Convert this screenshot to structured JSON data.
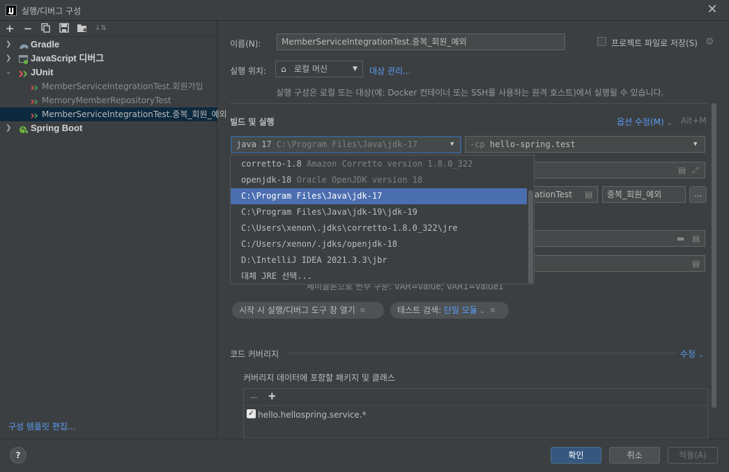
{
  "window": {
    "title": "실행/디버그 구성"
  },
  "left": {
    "toolbar": [
      "add",
      "remove",
      "copy",
      "save",
      "new-folder",
      "sort"
    ],
    "tree": [
      {
        "label": "Gradle",
        "kind": "group",
        "expanded": false
      },
      {
        "label": "JavaScript 디버그",
        "kind": "group",
        "expanded": false
      },
      {
        "label": "JUnit",
        "kind": "group",
        "expanded": true
      },
      {
        "label": "MemberServiceIntegrationTest.회원가입",
        "kind": "test"
      },
      {
        "label": "MemoryMemberRepositoryTest",
        "kind": "test"
      },
      {
        "label": "MemberServiceIntegrationTest.중복_회원_예외",
        "kind": "test",
        "selected": true
      },
      {
        "label": "Spring Boot",
        "kind": "group",
        "expanded": false
      }
    ],
    "template_link": "구성 템플릿 편집..."
  },
  "form": {
    "name_label": "이름(N):",
    "name_value": "MemberServiceIntegrationTest.중복_회원_예외",
    "save_to_project": "프로젝트 파일로 저장(S)",
    "run_on_label": "실행 위치:",
    "run_on_value": "로컬 머신",
    "manage_targets": "대상 관리...",
    "run_on_hint": "실행 구성은 로컬 또는 대상(예: Docker 컨테이너 또는 SSH를 사용하는 원격 호스트)에서 실행될 수 있습니다.",
    "build_run_header": "빌드 및 실행",
    "modify_options": "옵션 수정(M)",
    "modify_shortcut": "Alt+M",
    "jre_name": "java 17",
    "jre_path": "C:\\Program Files\\Java\\jdk-17",
    "cp_flag": "-cp",
    "cp_value": "hello-spring.test",
    "class_value_tail": "ationTest",
    "method_value": "중복_회원_예외",
    "browse_button": "...",
    "env_hint": "세미콜론으로 변수 구분: VAR=value; VAR1=value1",
    "chip_open_tool": "시작 시 실행/디버그 도구 창 열기",
    "chip_search_label": "테스트 검색:",
    "chip_search_value": "단일 모듈",
    "coverage_header": "코드 커버리지",
    "coverage_edit": "수정",
    "coverage_sub": "커버리지 데이터에 포함할 패키지 및 클래스",
    "coverage_item": "hello.hellospring.service.*"
  },
  "jre_dropdown": [
    {
      "main": "corretto-1.8",
      "sub": "Amazon Corretto version 1.8.0_322"
    },
    {
      "main": "openjdk-18",
      "sub": "Oracle OpenJDK version 18"
    },
    {
      "main": "C:\\Program Files\\Java\\jdk-17",
      "sub": "",
      "selected": true
    },
    {
      "main": "C:\\Program Files\\Java\\jdk-19\\jdk-19",
      "sub": ""
    },
    {
      "main": "C:\\Users\\xenon\\.jdks\\corretto-1.8.0_322\\jre",
      "sub": ""
    },
    {
      "main": "C:/Users/xenon/.jdks/openjdk-18",
      "sub": ""
    },
    {
      "main": "D:\\IntelliJ IDEA 2021.3.3\\jbr",
      "sub": ""
    },
    {
      "main": "대체 JRE 선택...",
      "sub": ""
    }
  ],
  "buttons": {
    "ok": "확인",
    "cancel": "취소",
    "apply": "적용(A)",
    "help": "?"
  },
  "colors": {
    "accent": "#4b6eaf",
    "link": "#589df6",
    "ok_button": "#365880",
    "selection": "#0d293e"
  }
}
